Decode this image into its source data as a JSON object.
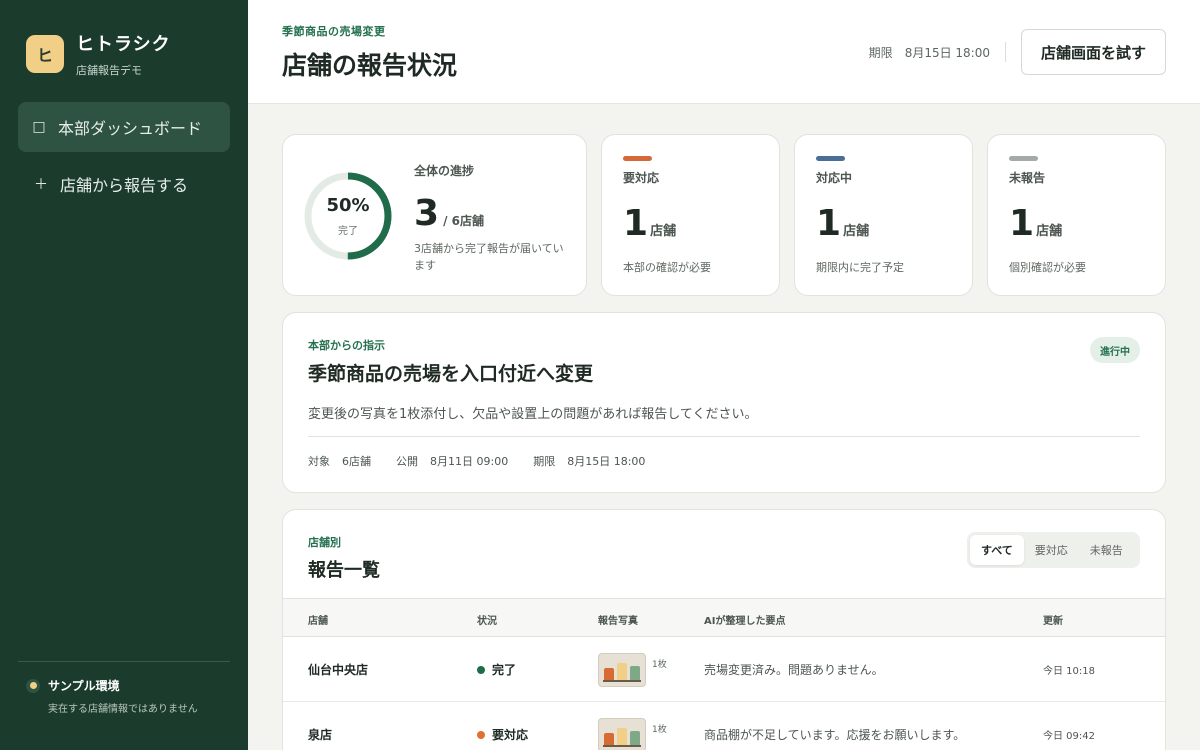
{
  "brand": {
    "logo": "ヒ",
    "name": "ヒトラシク",
    "subtitle": "店舗報告デモ"
  },
  "nav": [
    {
      "label": "本部ダッシュボード",
      "icon": "□",
      "icon_name": "square-icon",
      "active": true
    },
    {
      "label": "店舗から報告する",
      "icon": "＋",
      "icon_name": "plus-icon",
      "active": false
    }
  ],
  "sample": {
    "title": "サンプル環境",
    "subtitle": "実在する店舗情報ではありません"
  },
  "header": {
    "eyebrow": "季節商品の売場変更",
    "title": "店舗の報告状況",
    "deadline_label": "期限",
    "deadline_value": "8月15日 18:00",
    "try_button": "店舗画面を試す"
  },
  "progress": {
    "percent_label": "50%",
    "percent_value": 0.5,
    "ring_label": "完了",
    "title": "全体の進捗",
    "done": "3",
    "total_label": "/ 6店舗",
    "description": "3店舗から完了報告が届いています"
  },
  "stats": [
    {
      "title": "要対応",
      "value": "1",
      "unit": "店舗",
      "desc": "本部の確認が必要",
      "color": "#d4693a"
    },
    {
      "title": "対応中",
      "value": "1",
      "unit": "店舗",
      "desc": "期限内に完了予定",
      "color": "#4a6e96"
    },
    {
      "title": "未報告",
      "value": "1",
      "unit": "店舗",
      "desc": "個別確認が必要",
      "color": "#a6aaa6"
    }
  ],
  "instruction": {
    "eyebrow": "本部からの指示",
    "title": "季節商品の売場を入口付近へ変更",
    "badge": "進行中",
    "text": "変更後の写真を1枚添付し、欠品や設置上の問題があれば報告してください。",
    "target_label": "対象",
    "target_value": "6店舗",
    "published_label": "公開",
    "published_value": "8月11日 09:00",
    "deadline_label": "期限",
    "deadline_value": "8月15日 18:00"
  },
  "reports": {
    "eyebrow": "店舗別",
    "title": "報告一覧",
    "filters": [
      {
        "label": "すべて",
        "active": true
      },
      {
        "label": "要対応",
        "active": false
      },
      {
        "label": "未報告",
        "active": false
      }
    ],
    "columns": [
      "店舗",
      "状況",
      "報告写真",
      "AIが整理した要点",
      "更新"
    ],
    "rows": [
      {
        "store": "仙台中央店",
        "status": "完了",
        "status_color": "#1f6b4a",
        "photo_count": "1枚",
        "summary": "売場変更済み。問題ありません。",
        "updated": "今日 10:18"
      },
      {
        "store": "泉店",
        "status": "要対応",
        "status_color": "#e0712f",
        "photo_count": "1枚",
        "summary": "商品棚が不足しています。応援をお願いします。",
        "updated": "今日 09:42"
      }
    ]
  },
  "colors": {
    "sidebar": "#1b3b2d",
    "accent": "#24704f",
    "ring": "#1f6b4a",
    "ring_track": "#e4ebe6"
  }
}
